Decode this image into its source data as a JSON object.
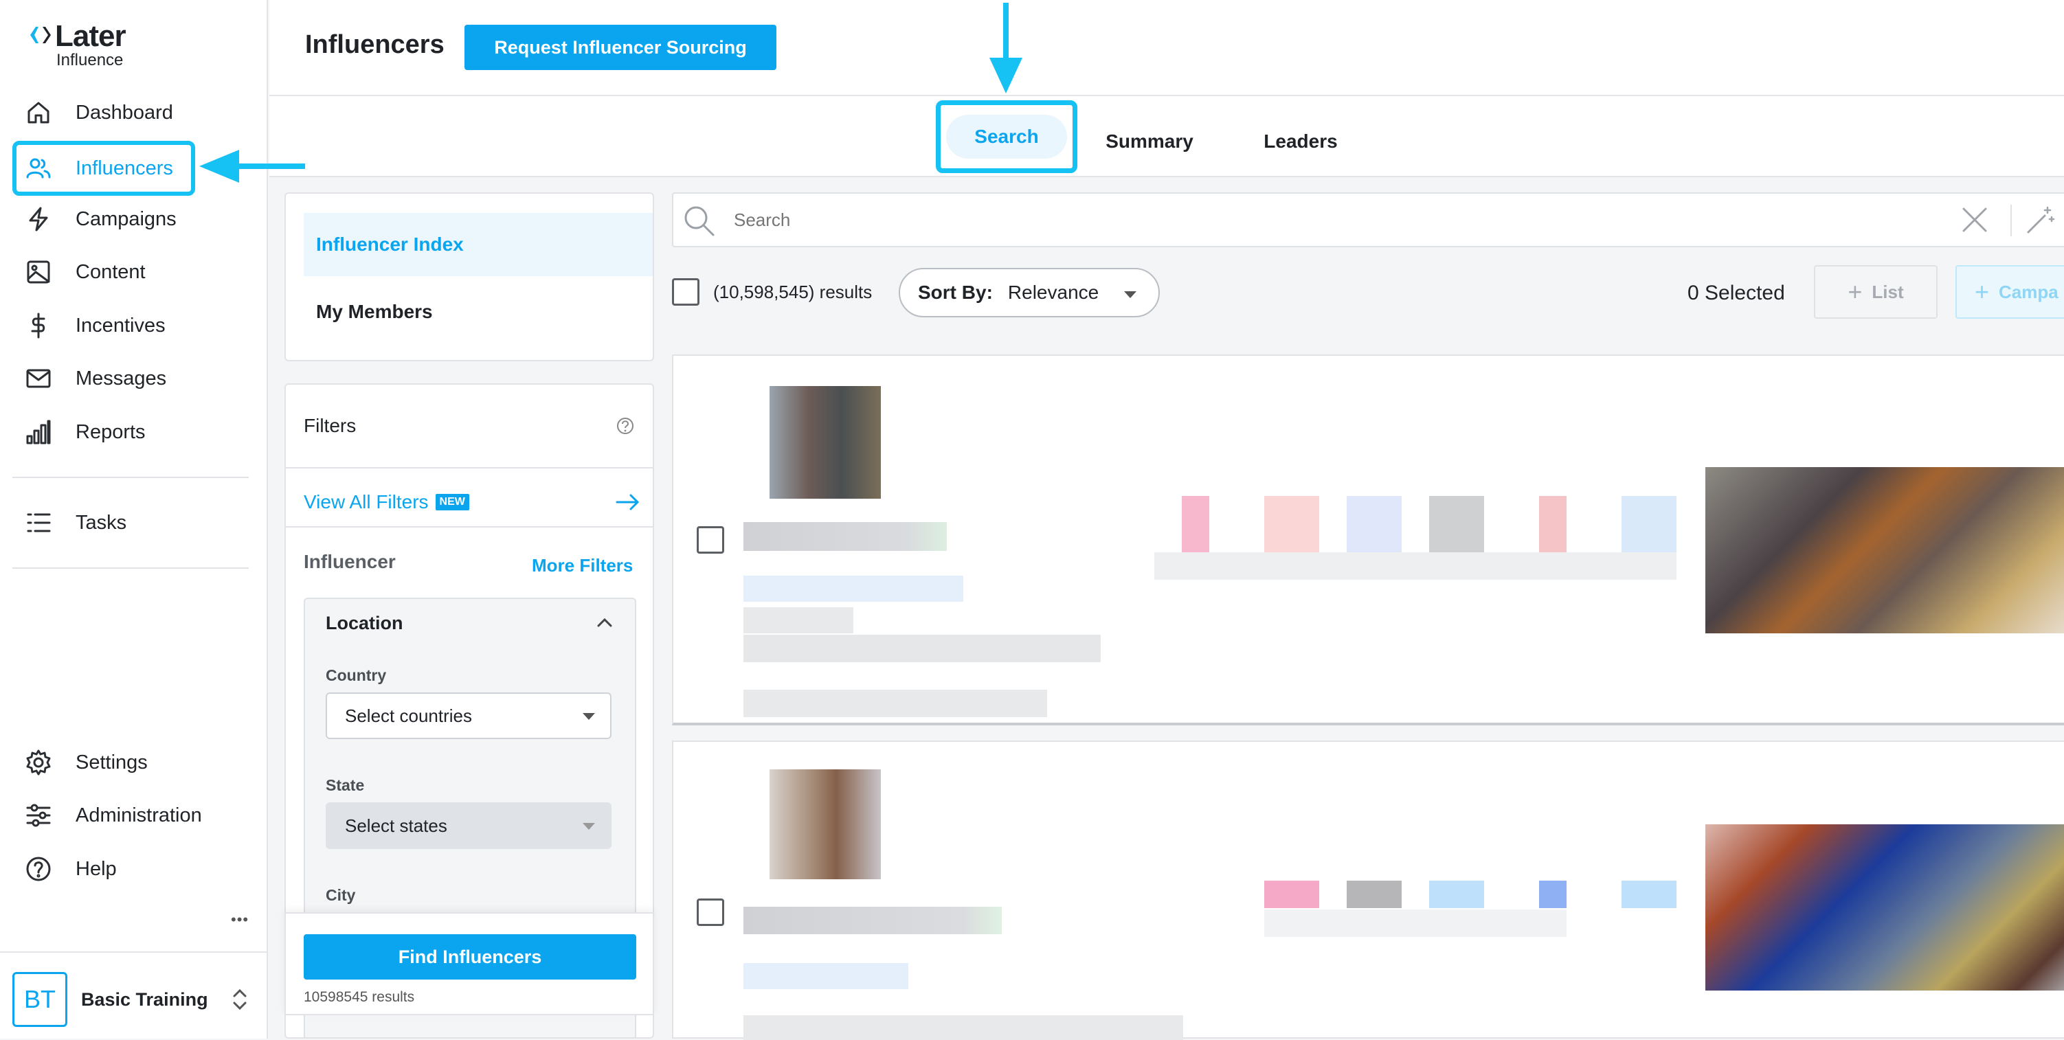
{
  "brand": {
    "name": "Later",
    "sub": "Influence"
  },
  "sidebar": {
    "items": [
      {
        "label": "Dashboard",
        "icon": "home-icon"
      },
      {
        "label": "Influencers",
        "icon": "users-icon"
      },
      {
        "label": "Campaigns",
        "icon": "lightning-icon"
      },
      {
        "label": "Content",
        "icon": "image-icon"
      },
      {
        "label": "Incentives",
        "icon": "dollar-icon"
      },
      {
        "label": "Messages",
        "icon": "mail-icon"
      },
      {
        "label": "Reports",
        "icon": "bar-chart-icon"
      },
      {
        "label": "Tasks",
        "icon": "list-icon"
      },
      {
        "label": "Settings",
        "icon": "gear-icon"
      },
      {
        "label": "Administration",
        "icon": "sliders-icon"
      },
      {
        "label": "Help",
        "icon": "help-icon"
      }
    ],
    "more": "•••",
    "account": {
      "initials": "BT",
      "name": "Basic Training"
    }
  },
  "header": {
    "title": "Influencers",
    "request_button": "Request Influencer Sourcing"
  },
  "tabs": [
    {
      "label": "Search",
      "active": true
    },
    {
      "label": "Summary",
      "active": false
    },
    {
      "label": "Leaders",
      "active": false
    }
  ],
  "index_panel": {
    "items": [
      "Influencer Index",
      "My Members"
    ]
  },
  "filters": {
    "title": "Filters",
    "view_all": "View All Filters",
    "new_badge": "NEW",
    "section": "Influencer",
    "more_filters": "More Filters",
    "location": {
      "title": "Location",
      "country_label": "Country",
      "country_value": "Select countries",
      "state_label": "State",
      "state_value": "Select states",
      "city_label": "City"
    },
    "find_button": "Find Influencers",
    "result_count": "10598545 results"
  },
  "search": {
    "placeholder": "Search"
  },
  "results": {
    "count_text": "(10,598,545) results",
    "sort_label": "Sort By:",
    "sort_value": "Relevance",
    "selected_text": "0 Selected",
    "list_button": "List",
    "campaign_button": "Campa"
  },
  "colors": {
    "accent": "#0aa5ee",
    "highlight": "#16c1f3"
  }
}
